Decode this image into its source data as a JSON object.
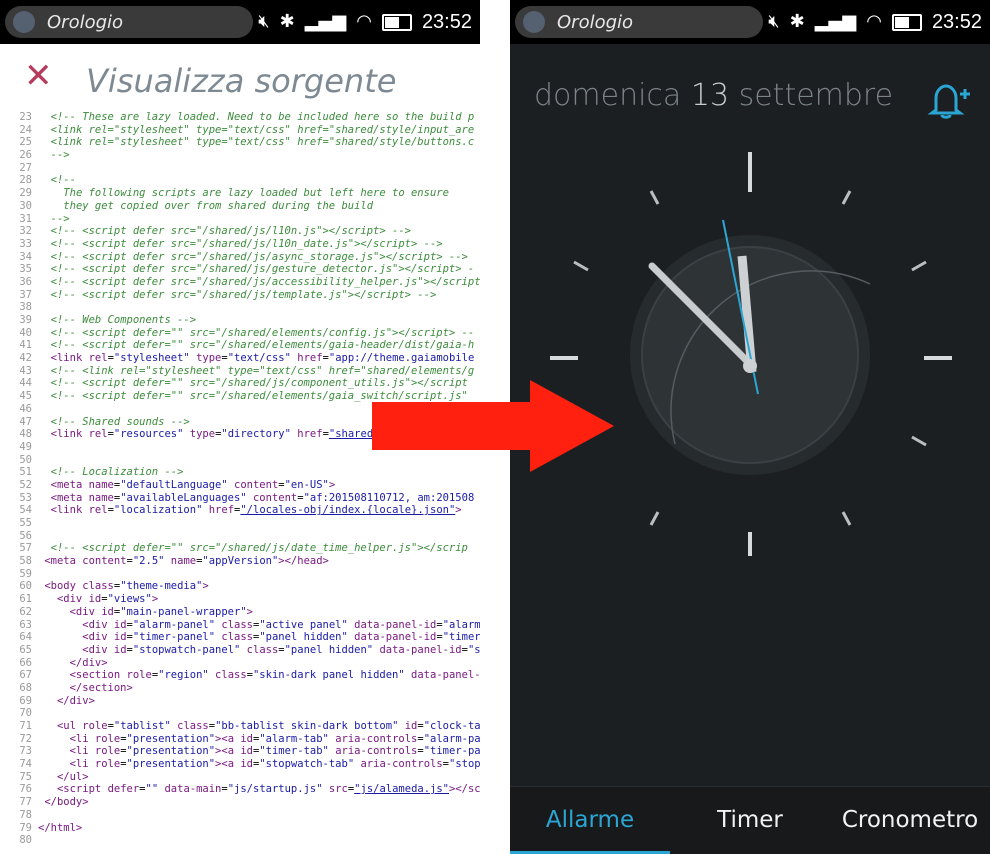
{
  "left_status": {
    "app_name": "Orologio",
    "time": "23:52"
  },
  "right_status": {
    "app_name": "Orologio",
    "time": "23:52"
  },
  "source_view": {
    "title": "Visualizza sorgente",
    "lines": [
      {
        "n": "23",
        "html": "  <span class='c-comment'>&lt;!-- These are lazy loaded. Need to be included here so the build p</span>"
      },
      {
        "n": "24",
        "html": "  <span class='c-comment'>&lt;link rel=\"stylesheet\" type=\"text/css\" href=\"shared/style/input_are</span>"
      },
      {
        "n": "25",
        "html": "  <span class='c-comment'>&lt;link rel=\"stylesheet\" type=\"text/css\" href=\"shared/style/buttons.c</span>"
      },
      {
        "n": "26",
        "html": "  <span class='c-comment'>--&gt;</span>"
      },
      {
        "n": "27",
        "html": ""
      },
      {
        "n": "28",
        "html": "  <span class='c-comment'>&lt;!--</span>"
      },
      {
        "n": "29",
        "html": "  <span class='c-comment'>  The following scripts are lazy loaded but left here to ensure</span>"
      },
      {
        "n": "30",
        "html": "  <span class='c-comment'>  they get copied over from shared during the build</span>"
      },
      {
        "n": "31",
        "html": "  <span class='c-comment'>--&gt;</span>"
      },
      {
        "n": "32",
        "html": "  <span class='c-comment'>&lt;!-- &lt;script defer src=\"/shared/js/l10n.js\"&gt;&lt;/script&gt; --&gt;</span>"
      },
      {
        "n": "33",
        "html": "  <span class='c-comment'>&lt;!-- &lt;script defer src=\"/shared/js/l10n_date.js\"&gt;&lt;/script&gt; --&gt;</span>"
      },
      {
        "n": "34",
        "html": "  <span class='c-comment'>&lt;!-- &lt;script defer src=\"/shared/js/async_storage.js\"&gt;&lt;/script&gt; --&gt;</span>"
      },
      {
        "n": "35",
        "html": "  <span class='c-comment'>&lt;!-- &lt;script defer src=\"/shared/js/gesture_detector.js\"&gt;&lt;/script&gt; -</span>"
      },
      {
        "n": "36",
        "html": "  <span class='c-comment'>&lt;!-- &lt;script defer src=\"/shared/js/accessibility_helper.js\"&gt;&lt;/script</span>"
      },
      {
        "n": "37",
        "html": "  <span class='c-comment'>&lt;!-- &lt;script defer src=\"/shared/js/template.js\"&gt;&lt;/script&gt; --&gt;</span>"
      },
      {
        "n": "38",
        "html": ""
      },
      {
        "n": "39",
        "html": "  <span class='c-comment'>&lt;!-- Web Components --&gt;</span>"
      },
      {
        "n": "40",
        "html": "  <span class='c-comment'>&lt;!-- &lt;script defer=\"\" src=\"/shared/elements/config.js\"&gt;&lt;/script&gt; --</span>"
      },
      {
        "n": "41",
        "html": "  <span class='c-comment'>&lt;!-- &lt;script defer=\"\" src=\"/shared/elements/gaia-header/dist/gaia-h</span>"
      },
      {
        "n": "42",
        "html": "  <span class='c-tag'>&lt;link</span> <span class='c-tag'>rel</span>=<span class='c-val'>\"stylesheet\"</span> <span class='c-tag'>type</span>=<span class='c-val'>\"text/css\"</span> <span class='c-tag'>href</span>=<span class='c-val'>\"app://theme.gaiamobile</span>"
      },
      {
        "n": "43",
        "html": "  <span class='c-comment'>&lt;!-- &lt;link rel=\"stylesheet\" type=\"text/css\" href=\"shared/elements/g</span>"
      },
      {
        "n": "44",
        "html": "  <span class='c-comment'>&lt;!-- &lt;script defer=\"\" src=\"/shared/js/component_utils.js\"&gt;&lt;/script</span>"
      },
      {
        "n": "45",
        "html": "  <span class='c-comment'>&lt;!-- &lt;script defer=\"\" src=\"/shared/elements/gaia_switch/script.js\"</span>"
      },
      {
        "n": "46",
        "html": ""
      },
      {
        "n": "47",
        "html": "  <span class='c-comment'>&lt;!-- Shared sounds --&gt;</span>"
      },
      {
        "n": "48",
        "html": "  <span class='c-tag'>&lt;link</span> <span class='c-tag'>rel</span>=<span class='c-val'>\"resources\"</span> <span class='c-tag'>type</span>=<span class='c-val'>\"directory\"</span> <span class='c-tag'>href</span>=<span class='c-link'>\"shared</span>"
      },
      {
        "n": "49",
        "html": ""
      },
      {
        "n": "50",
        "html": ""
      },
      {
        "n": "51",
        "html": "  <span class='c-comment'>&lt;!-- Localization --&gt;</span>"
      },
      {
        "n": "52",
        "html": "  <span class='c-tag'>&lt;meta</span> <span class='c-tag'>name</span>=<span class='c-val'>\"defaultLanguage\"</span> <span class='c-tag'>content</span>=<span class='c-val'>\"en-US\"</span><span class='c-tag'>&gt;</span>"
      },
      {
        "n": "53",
        "html": "  <span class='c-tag'>&lt;meta</span> <span class='c-tag'>name</span>=<span class='c-val'>\"availableLanguages\"</span> <span class='c-tag'>content</span>=<span class='c-val'>\"af:201508110712, am:201508</span>"
      },
      {
        "n": "54",
        "html": "  <span class='c-tag'>&lt;link</span> <span class='c-tag'>rel</span>=<span class='c-val'>\"localization\"</span> <span class='c-tag'>href</span>=<span class='c-link'>\"/locales-obj/index.{locale}.json\"</span><span class='c-tag'>&gt;</span>"
      },
      {
        "n": "55",
        "html": ""
      },
      {
        "n": "56",
        "html": ""
      },
      {
        "n": "57",
        "html": "  <span class='c-comment'>&lt;!-- &lt;script defer=\"\" src=\"/shared/js/date_time_helper.js\"&gt;&lt;/scrip</span>"
      },
      {
        "n": "58",
        "html": " <span class='c-tag'>&lt;meta</span> <span class='c-tag'>content</span>=<span class='c-val'>\"2.5\"</span> <span class='c-tag'>name</span>=<span class='c-val'>\"appVersion\"</span><span class='c-tag'>&gt;&lt;/head&gt;</span>"
      },
      {
        "n": "59",
        "html": ""
      },
      {
        "n": "60",
        "html": " <span class='c-tag'>&lt;body</span> <span class='c-tag'>class</span>=<span class='c-val'>\"theme-media\"</span><span class='c-tag'>&gt;</span>"
      },
      {
        "n": "61",
        "html": "   <span class='c-tag'>&lt;div</span> <span class='c-tag'>id</span>=<span class='c-val'>\"views\"</span><span class='c-tag'>&gt;</span>"
      },
      {
        "n": "62",
        "html": "     <span class='c-tag'>&lt;div</span> <span class='c-tag'>id</span>=<span class='c-val'>\"main-panel-wrapper\"</span><span class='c-tag'>&gt;</span>"
      },
      {
        "n": "63",
        "html": "       <span class='c-tag'>&lt;div</span> <span class='c-tag'>id</span>=<span class='c-val'>\"alarm-panel\"</span> <span class='c-tag'>class</span>=<span class='c-val'>\"active panel\"</span> <span class='c-tag'>data-panel-id</span>=<span class='c-val'>\"alarm</span>"
      },
      {
        "n": "64",
        "html": "       <span class='c-tag'>&lt;div</span> <span class='c-tag'>id</span>=<span class='c-val'>\"timer-panel\"</span> <span class='c-tag'>class</span>=<span class='c-val'>\"panel hidden\"</span> <span class='c-tag'>data-panel-id</span>=<span class='c-val'>\"timer</span>"
      },
      {
        "n": "65",
        "html": "       <span class='c-tag'>&lt;div</span> <span class='c-tag'>id</span>=<span class='c-val'>\"stopwatch-panel\"</span> <span class='c-tag'>class</span>=<span class='c-val'>\"panel hidden\"</span> <span class='c-tag'>data-panel-id</span>=<span class='c-val'>\"s</span>"
      },
      {
        "n": "66",
        "html": "     <span class='c-tag'>&lt;/div&gt;</span>"
      },
      {
        "n": "67",
        "html": "     <span class='c-tag'>&lt;section</span> <span class='c-tag'>role</span>=<span class='c-val'>\"region\"</span> <span class='c-tag'>class</span>=<span class='c-val'>\"skin-dark panel hidden\"</span> <span class='c-tag'>data-panel-</span>"
      },
      {
        "n": "68",
        "html": "     <span class='c-tag'>&lt;/section&gt;</span>"
      },
      {
        "n": "69",
        "html": "   <span class='c-tag'>&lt;/div&gt;</span>"
      },
      {
        "n": "70",
        "html": ""
      },
      {
        "n": "71",
        "html": "   <span class='c-tag'>&lt;ul</span> <span class='c-tag'>role</span>=<span class='c-val'>\"tablist\"</span> <span class='c-tag'>class</span>=<span class='c-val'>\"bb-tablist skin-dark bottom\"</span> <span class='c-tag'>id</span>=<span class='c-val'>\"clock-ta</span>"
      },
      {
        "n": "72",
        "html": "     <span class='c-tag'>&lt;li</span> <span class='c-tag'>role</span>=<span class='c-val'>\"presentation\"</span><span class='c-tag'>&gt;&lt;a</span> <span class='c-tag'>id</span>=<span class='c-val'>\"alarm-tab\"</span> <span class='c-tag'>aria-controls</span>=<span class='c-val'>\"alarm-pa</span>"
      },
      {
        "n": "73",
        "html": "     <span class='c-tag'>&lt;li</span> <span class='c-tag'>role</span>=<span class='c-val'>\"presentation\"</span><span class='c-tag'>&gt;&lt;a</span> <span class='c-tag'>id</span>=<span class='c-val'>\"timer-tab\"</span> <span class='c-tag'>aria-controls</span>=<span class='c-val'>\"timer-pa</span>"
      },
      {
        "n": "74",
        "html": "     <span class='c-tag'>&lt;li</span> <span class='c-tag'>role</span>=<span class='c-val'>\"presentation\"</span><span class='c-tag'>&gt;&lt;a</span> <span class='c-tag'>id</span>=<span class='c-val'>\"stopwatch-tab\"</span> <span class='c-tag'>aria-controls</span>=<span class='c-val'>\"stop</span>"
      },
      {
        "n": "75",
        "html": "   <span class='c-tag'>&lt;/ul&gt;</span>"
      },
      {
        "n": "76",
        "html": "   <span class='c-tag'>&lt;script</span> <span class='c-tag'>defer</span>=<span class='c-val'>\"\"</span> <span class='c-tag'>data-main</span>=<span class='c-val'>\"js/startup.js\"</span> <span class='c-tag'>src</span>=<span class='c-link'>\"js/alameda.js\"</span><span class='c-tag'>&gt;&lt;/sc</span>"
      },
      {
        "n": "77",
        "html": " <span class='c-tag'>&lt;/body&gt;</span>"
      },
      {
        "n": "78",
        "html": ""
      },
      {
        "n": "79",
        "html": "<span class='c-tag'>&lt;/html&gt;</span>"
      },
      {
        "n": "80",
        "html": ""
      }
    ]
  },
  "clock_app": {
    "weekday": "domenica",
    "day": "13",
    "month": "settembre",
    "tabs": [
      "Allarme",
      "Timer",
      "Cronometro"
    ],
    "active_tab": "Allarme",
    "colors": {
      "accent": "#2ba6d4",
      "background": "#1b1f21"
    }
  },
  "icons": {
    "close": "close-icon",
    "add_alarm": "bell-plus-icon",
    "arrow": "red-arrow-right"
  }
}
